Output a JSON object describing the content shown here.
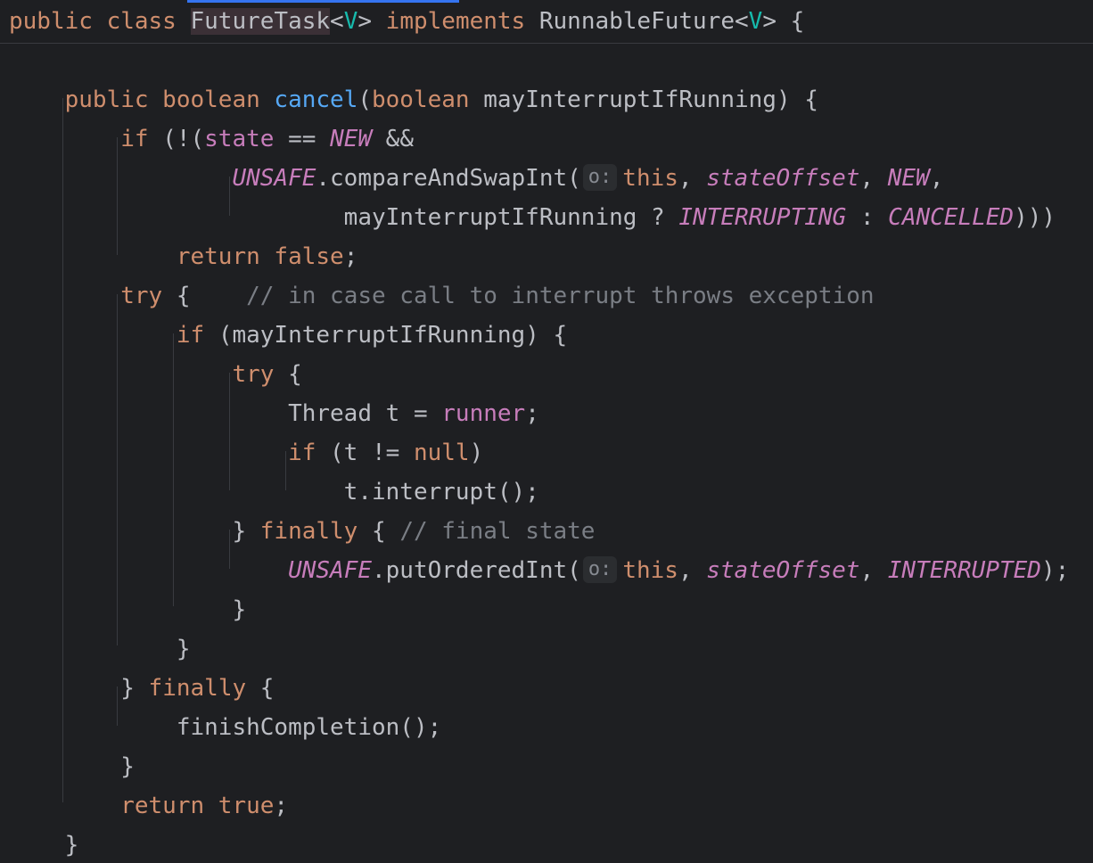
{
  "editor": {
    "lines": [
      [
        {
          "t": "public class ",
          "c": "kw"
        },
        {
          "t": "FutureTask",
          "c": "typ hl"
        },
        {
          "t": "<",
          "c": "typ"
        },
        {
          "t": "V",
          "c": "tp"
        },
        {
          "t": "> ",
          "c": "typ"
        },
        {
          "t": "implements ",
          "c": "kw"
        },
        {
          "t": "RunnableFuture<",
          "c": "typ"
        },
        {
          "t": "V",
          "c": "tp"
        },
        {
          "t": "> {",
          "c": "typ"
        }
      ],
      [],
      [
        {
          "t": "    public boolean ",
          "c": "kw"
        },
        {
          "t": "cancel",
          "c": "fn"
        },
        {
          "t": "(",
          "c": "typ"
        },
        {
          "t": "boolean ",
          "c": "kw"
        },
        {
          "t": "mayInterruptIfRunning) {",
          "c": "typ"
        }
      ],
      [
        {
          "t": "        if ",
          "c": "kw"
        },
        {
          "t": "(!(",
          "c": "typ"
        },
        {
          "t": "state",
          "c": "fld"
        },
        {
          "t": " == ",
          "c": "typ"
        },
        {
          "t": "NEW",
          "c": "sfld"
        },
        {
          "t": " &&",
          "c": "typ"
        }
      ],
      [
        {
          "t": "                ",
          "c": "typ"
        },
        {
          "t": "UNSAFE",
          "c": "sfld"
        },
        {
          "t": ".compareAndSwapInt(",
          "c": "typ"
        },
        {
          "t": "o:",
          "c": "hint"
        },
        {
          "t": "this",
          "c": "kw"
        },
        {
          "t": ", ",
          "c": "typ"
        },
        {
          "t": "stateOffset",
          "c": "sfld"
        },
        {
          "t": ", ",
          "c": "typ"
        },
        {
          "t": "NEW",
          "c": "sfld"
        },
        {
          "t": ",",
          "c": "typ"
        }
      ],
      [
        {
          "t": "                        mayInterruptIfRunning ? ",
          "c": "typ"
        },
        {
          "t": "INTERRUPTING",
          "c": "sfld"
        },
        {
          "t": " : ",
          "c": "typ"
        },
        {
          "t": "CANCELLED",
          "c": "sfld"
        },
        {
          "t": ")))",
          "c": "typ"
        }
      ],
      [
        {
          "t": "            return false",
          "c": "kw"
        },
        {
          "t": ";",
          "c": "typ"
        }
      ],
      [
        {
          "t": "        try ",
          "c": "kw"
        },
        {
          "t": "{    ",
          "c": "typ"
        },
        {
          "t": "// in case call to interrupt throws exception",
          "c": "cm"
        }
      ],
      [
        {
          "t": "            if ",
          "c": "kw"
        },
        {
          "t": "(mayInterruptIfRunning) {",
          "c": "typ"
        }
      ],
      [
        {
          "t": "                try ",
          "c": "kw"
        },
        {
          "t": "{",
          "c": "typ"
        }
      ],
      [
        {
          "t": "                    Thread t = ",
          "c": "typ"
        },
        {
          "t": "runner",
          "c": "fld"
        },
        {
          "t": ";",
          "c": "typ"
        }
      ],
      [
        {
          "t": "                    if ",
          "c": "kw"
        },
        {
          "t": "(t != ",
          "c": "typ"
        },
        {
          "t": "null",
          "c": "kw"
        },
        {
          "t": ")",
          "c": "typ"
        }
      ],
      [
        {
          "t": "                        t.interrupt();",
          "c": "typ"
        }
      ],
      [
        {
          "t": "                } ",
          "c": "typ"
        },
        {
          "t": "finally ",
          "c": "kw"
        },
        {
          "t": "{ ",
          "c": "typ"
        },
        {
          "t": "// final state",
          "c": "cm"
        }
      ],
      [
        {
          "t": "                    ",
          "c": "typ"
        },
        {
          "t": "UNSAFE",
          "c": "sfld"
        },
        {
          "t": ".putOrderedInt(",
          "c": "typ"
        },
        {
          "t": "o:",
          "c": "hint"
        },
        {
          "t": "this",
          "c": "kw"
        },
        {
          "t": ", ",
          "c": "typ"
        },
        {
          "t": "stateOffset",
          "c": "sfld"
        },
        {
          "t": ", ",
          "c": "typ"
        },
        {
          "t": "INTERRUPTED",
          "c": "sfld"
        },
        {
          "t": ");",
          "c": "typ"
        }
      ],
      [
        {
          "t": "                }",
          "c": "typ"
        }
      ],
      [
        {
          "t": "            }",
          "c": "typ"
        }
      ],
      [
        {
          "t": "        } ",
          "c": "typ"
        },
        {
          "t": "finally ",
          "c": "kw"
        },
        {
          "t": "{",
          "c": "typ"
        }
      ],
      [
        {
          "t": "            finishCompletion();",
          "c": "typ"
        }
      ],
      [
        {
          "t": "        }",
          "c": "typ"
        }
      ],
      [
        {
          "t": "        return true",
          "c": "kw"
        },
        {
          "t": ";",
          "c": "typ"
        }
      ],
      [
        {
          "t": "    }",
          "c": "typ"
        }
      ]
    ]
  }
}
